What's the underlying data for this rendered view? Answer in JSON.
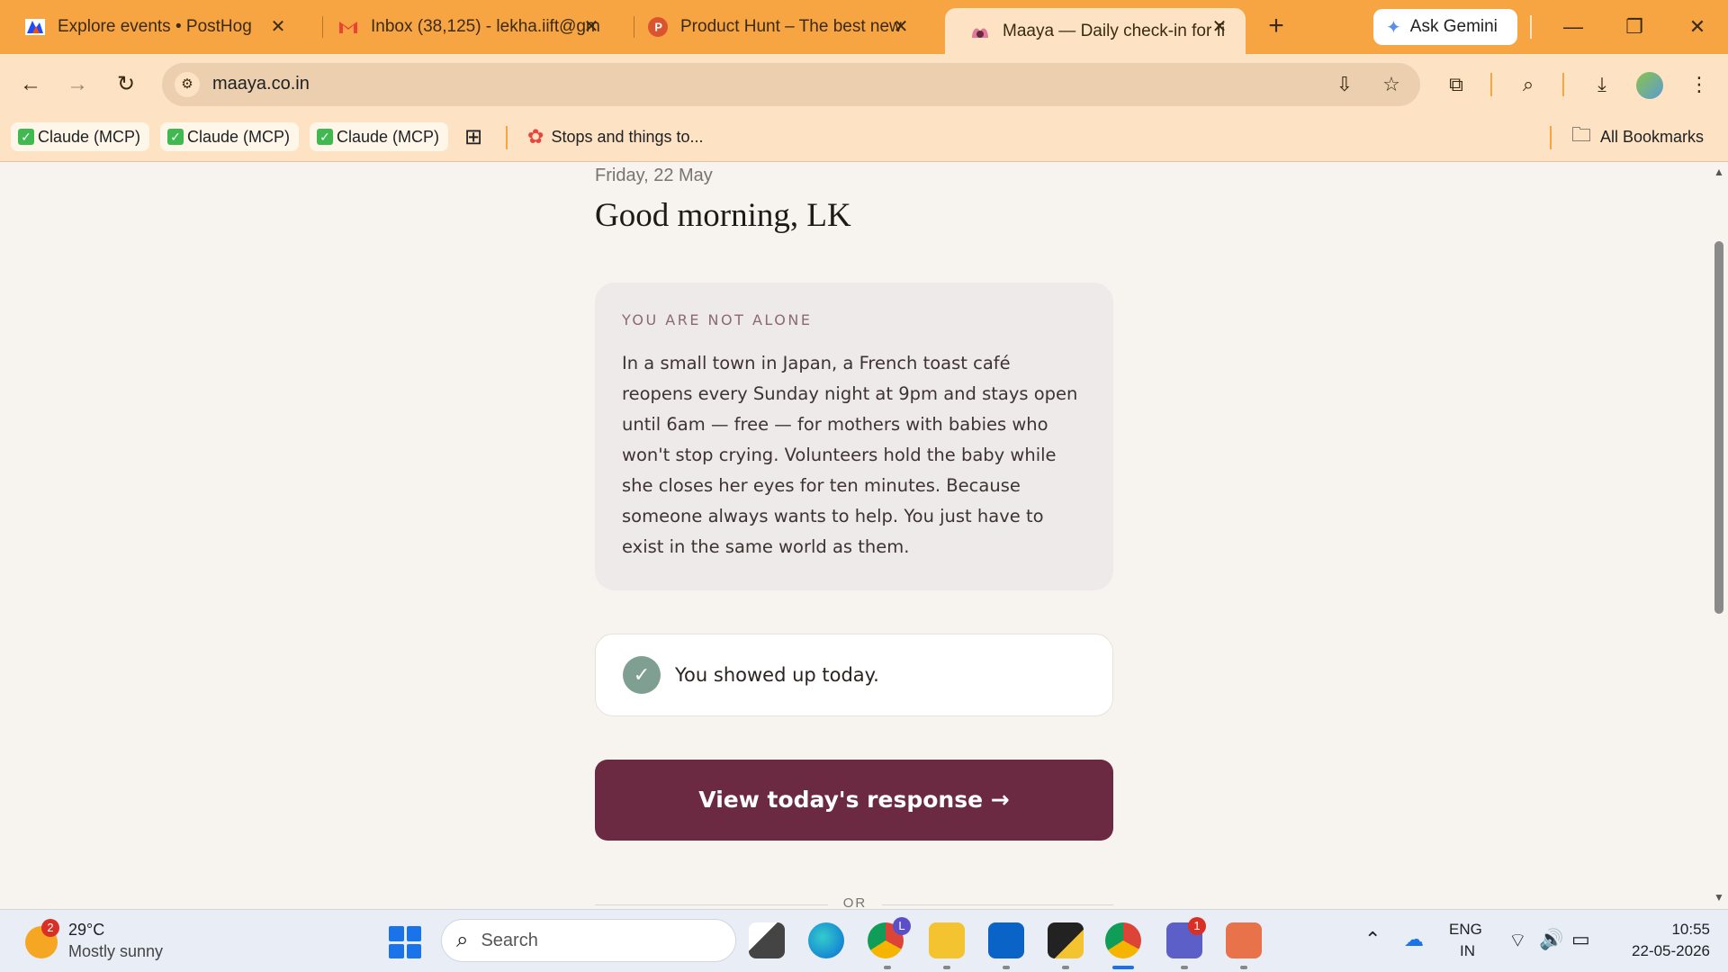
{
  "browser": {
    "tabs": [
      {
        "title": "Explore events • PostHog",
        "icon": "posthog-icon",
        "active": false
      },
      {
        "title": "Inbox (38,125) - lekha.iift@gm",
        "icon": "gmail-icon",
        "active": false
      },
      {
        "title": "Product Hunt – The best new",
        "icon": "producthunt-icon",
        "active": false
      },
      {
        "title": "Maaya — Daily check-in for fi",
        "icon": "maaya-icon",
        "active": true
      }
    ],
    "new_tab_glyph": "+",
    "gemini_label": "Ask Gemini",
    "url": "maaya.co.in",
    "bookmarks": [
      {
        "label": "Claude (MCP)"
      },
      {
        "label": "Claude (MCP)"
      },
      {
        "label": "Claude (MCP)"
      }
    ],
    "bookmark_folder": "Stops and things to...",
    "all_bookmarks": "All Bookmarks"
  },
  "page": {
    "date": "Friday, 22 May",
    "greeting": "Good morning, LK",
    "story": {
      "label": "YOU ARE NOT ALONE",
      "text": "In a small town in Japan, a French toast café reopens every Sunday night at 9pm and stays open until 6am — free — for mothers with babies who won't stop crying. Volunteers hold the baby while she closes her eyes for ten minutes. Because someone always wants to help. You just have to exist in the same world as them."
    },
    "status": {
      "text": "You showed up today."
    },
    "cta_label": "View today's response →",
    "divider_text": "OR"
  },
  "taskbar": {
    "weather_badge": "2",
    "temperature": "29°C",
    "weather": "Mostly sunny",
    "search_placeholder": "Search",
    "chrome_badge": "L",
    "teams_badge": "1",
    "lang_top": "ENG",
    "lang_bottom": "IN",
    "time": "10:55",
    "date": "22-05-2026"
  },
  "colors": {
    "tabbar": "#f7a543",
    "toolbar": "#fde3c4",
    "page_bg": "#f7f3ef",
    "cta": "#6b2a41",
    "check": "#7f9f92"
  }
}
